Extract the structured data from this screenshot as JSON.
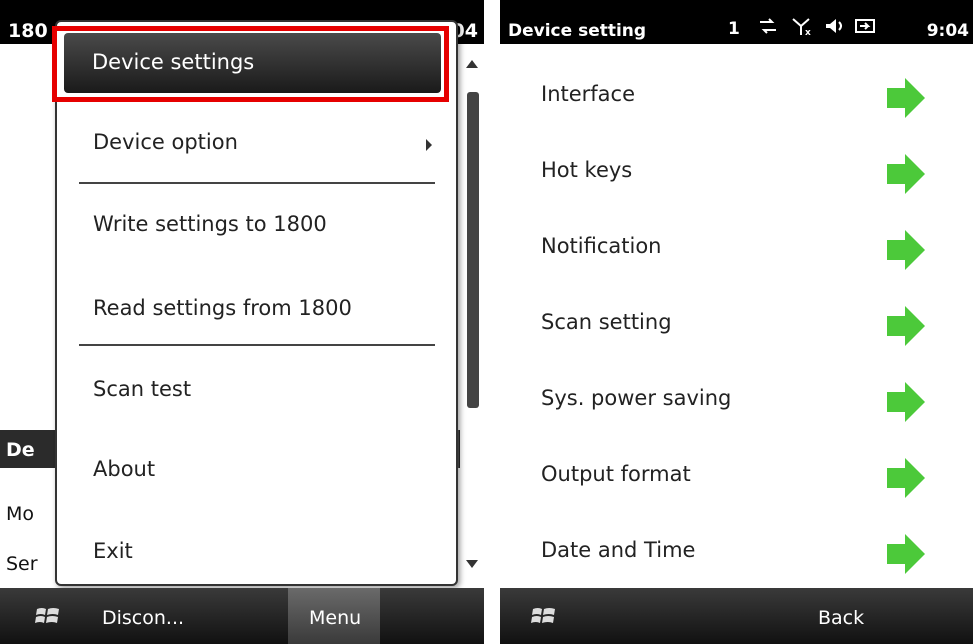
{
  "left_screen": {
    "status": {
      "app_fragment": "180",
      "time_fragment": "04"
    },
    "background": {
      "section_header": "De",
      "rows": [
        "Mo",
        "Ser"
      ]
    },
    "menu": {
      "items": [
        {
          "label": "Device settings",
          "selected": true
        },
        {
          "label": "Device option",
          "has_submenu": true
        },
        {
          "label": "Write settings to 1800"
        },
        {
          "label": "Read settings from 1800"
        },
        {
          "label": "Scan test"
        },
        {
          "label": "About"
        },
        {
          "label": "Exit"
        }
      ]
    },
    "taskbar": {
      "left_label": "Discon...",
      "right_label": "Menu"
    }
  },
  "right_screen": {
    "status": {
      "title": "Device setting",
      "count": "1",
      "time": "9:04"
    },
    "rows": [
      {
        "label": "Interface",
        "icon": "green-arrow-icon"
      },
      {
        "label": "Hot keys",
        "icon": "green-arrow-icon"
      },
      {
        "label": "Notification",
        "icon": "green-arrow-icon"
      },
      {
        "label": "Scan setting",
        "icon": "green-arrow-icon"
      },
      {
        "label": "Sys. power saving",
        "icon": "green-arrow-icon"
      },
      {
        "label": "Output format",
        "icon": "green-arrow-icon"
      },
      {
        "label": "Date and Time",
        "icon": "green-arrow-icon"
      }
    ],
    "taskbar": {
      "right_label": "Back"
    }
  },
  "colors": {
    "highlight": "#e60000",
    "arrow": "#4cc93a",
    "taskbar": "#1a1a1a"
  }
}
